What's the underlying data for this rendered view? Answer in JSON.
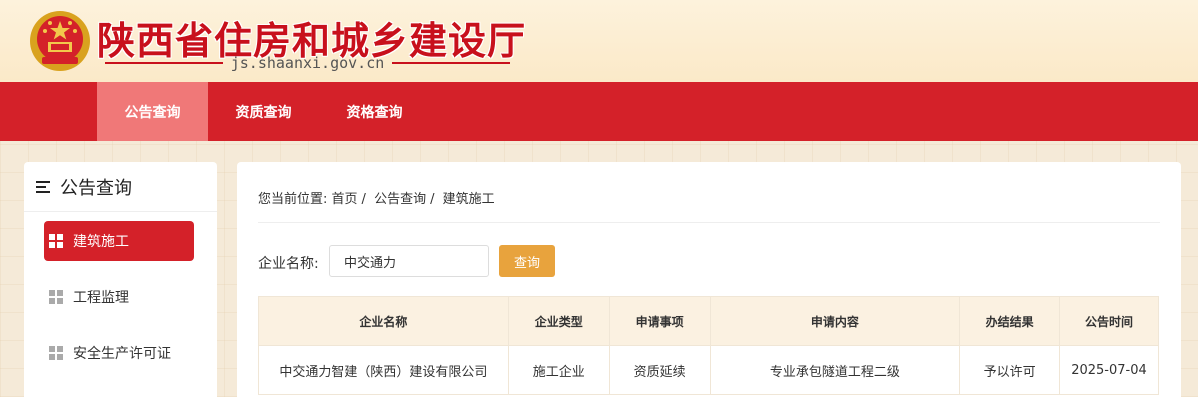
{
  "header": {
    "site_title": "陕西省住房和城乡建设厅",
    "site_url": "js.shaanxi.gov.cn",
    "emblem_icon": "national-emblem-icon"
  },
  "nav": {
    "items": [
      {
        "label": "公告查询",
        "active": true
      },
      {
        "label": "资质查询",
        "active": false
      },
      {
        "label": "资格查询",
        "active": false
      }
    ]
  },
  "sidebar": {
    "title": "公告查询",
    "title_icon": "menu-icon",
    "items": [
      {
        "label": "建筑施工",
        "active": true,
        "icon": "grid-icon"
      },
      {
        "label": "工程监理",
        "active": false,
        "icon": "grid-icon"
      },
      {
        "label": "安全生产许可证",
        "active": false,
        "icon": "grid-icon"
      }
    ]
  },
  "breadcrumb": {
    "prefix": "您当前位置:",
    "items": [
      "首页",
      "公告查询",
      "建筑施工"
    ]
  },
  "search": {
    "label": "企业名称:",
    "value": "中交通力",
    "button_label": "查询"
  },
  "table": {
    "columns": [
      "企业名称",
      "企业类型",
      "申请事项",
      "申请内容",
      "办结结果",
      "公告时间"
    ],
    "rows": [
      [
        "中交通力智建（陕西）建设有限公司",
        "施工企业",
        "资质延续",
        "专业承包隧道工程二级",
        "予以许可",
        "2025-07-04"
      ]
    ]
  },
  "colors": {
    "brand_red": "#d42129",
    "nav_active": "#f07878",
    "button_orange": "#e8a33d",
    "header_bg": "#fbe9c8"
  }
}
